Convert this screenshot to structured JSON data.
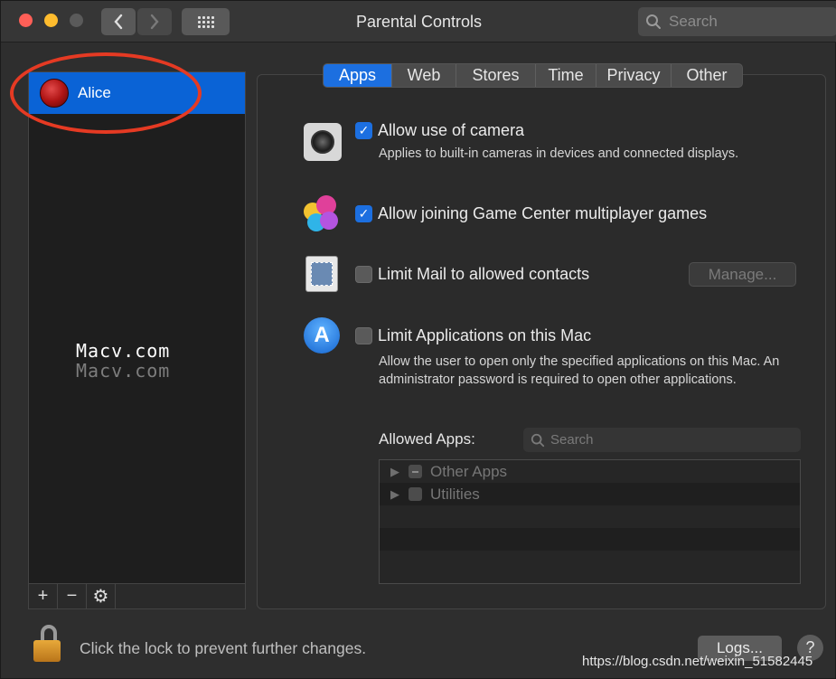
{
  "window": {
    "title": "Parental Controls",
    "search_placeholder": "Search"
  },
  "sidebar": {
    "users": [
      {
        "name": "Alice"
      }
    ],
    "bottom_buttons": [
      "+",
      "−",
      "⚙"
    ],
    "watermark": "Macv.com"
  },
  "tabs": [
    {
      "label": "Apps",
      "active": true
    },
    {
      "label": "Web",
      "active": false
    },
    {
      "label": "Stores",
      "active": false
    },
    {
      "label": "Time",
      "active": false
    },
    {
      "label": "Privacy",
      "active": false
    },
    {
      "label": "Other",
      "active": false
    }
  ],
  "settings": {
    "camera": {
      "label": "Allow use of camera",
      "checked": true,
      "description": "Applies to built-in cameras in devices and connected displays."
    },
    "game_center": {
      "label": "Allow joining Game Center multiplayer games",
      "checked": true
    },
    "mail": {
      "label": "Limit Mail to allowed contacts",
      "checked": false,
      "manage_label": "Manage..."
    },
    "applications": {
      "label": "Limit Applications on this Mac",
      "checked": false,
      "description": "Allow the user to open only the specified applications on this Mac. An administrator password is required to open other applications."
    }
  },
  "allowed_apps": {
    "label": "Allowed Apps:",
    "search_placeholder": "Search",
    "items": [
      {
        "label": "Other Apps"
      },
      {
        "label": "Utilities"
      }
    ]
  },
  "footer": {
    "lock_text": "Click the lock to prevent further changes.",
    "logs_label": "Logs...",
    "help_label": "?",
    "url_watermark": "https://blog.csdn.net/weixin_51582445"
  },
  "colors": {
    "accent": "#1c6fe0",
    "selection": "#0a63d6",
    "annotation": "#e53a23"
  }
}
